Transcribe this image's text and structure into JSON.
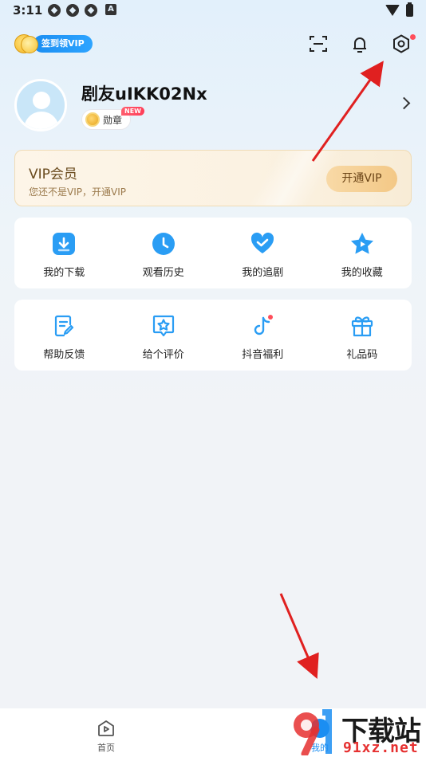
{
  "status_bar": {
    "time": "3:11",
    "indicator_letter": "A"
  },
  "header": {
    "checkin_label": "签到领VIP",
    "icons": [
      "scan-icon",
      "notification-bell-icon",
      "settings-gear-icon"
    ]
  },
  "profile": {
    "username": "剧友uIKK02Nx",
    "badge_label": "勋章",
    "new_tag": "NEW"
  },
  "vip": {
    "title": "VIP会员",
    "subtitle": "您还不是VIP，开通VIP",
    "button_label": "开通VIP"
  },
  "grid1": [
    {
      "label": "我的下载",
      "icon": "download-icon"
    },
    {
      "label": "观看历史",
      "icon": "history-clock-icon"
    },
    {
      "label": "我的追剧",
      "icon": "heart-check-icon"
    },
    {
      "label": "我的收藏",
      "icon": "star-icon"
    }
  ],
  "grid2": [
    {
      "label": "帮助反馈",
      "icon": "feedback-document-icon"
    },
    {
      "label": "给个评价",
      "icon": "rating-star-icon"
    },
    {
      "label": "抖音福利",
      "icon": "douyin-icon"
    },
    {
      "label": "礼品码",
      "icon": "gift-icon"
    }
  ],
  "bottom_nav": {
    "home_label": "首页",
    "mine_label": "我的"
  },
  "watermark": {
    "title": "下载站",
    "site": "91xz.net"
  },
  "colors": {
    "accent_blue": "#1b8ef2",
    "vip_gold": "#f3c886",
    "annotation_red": "#e02020"
  }
}
